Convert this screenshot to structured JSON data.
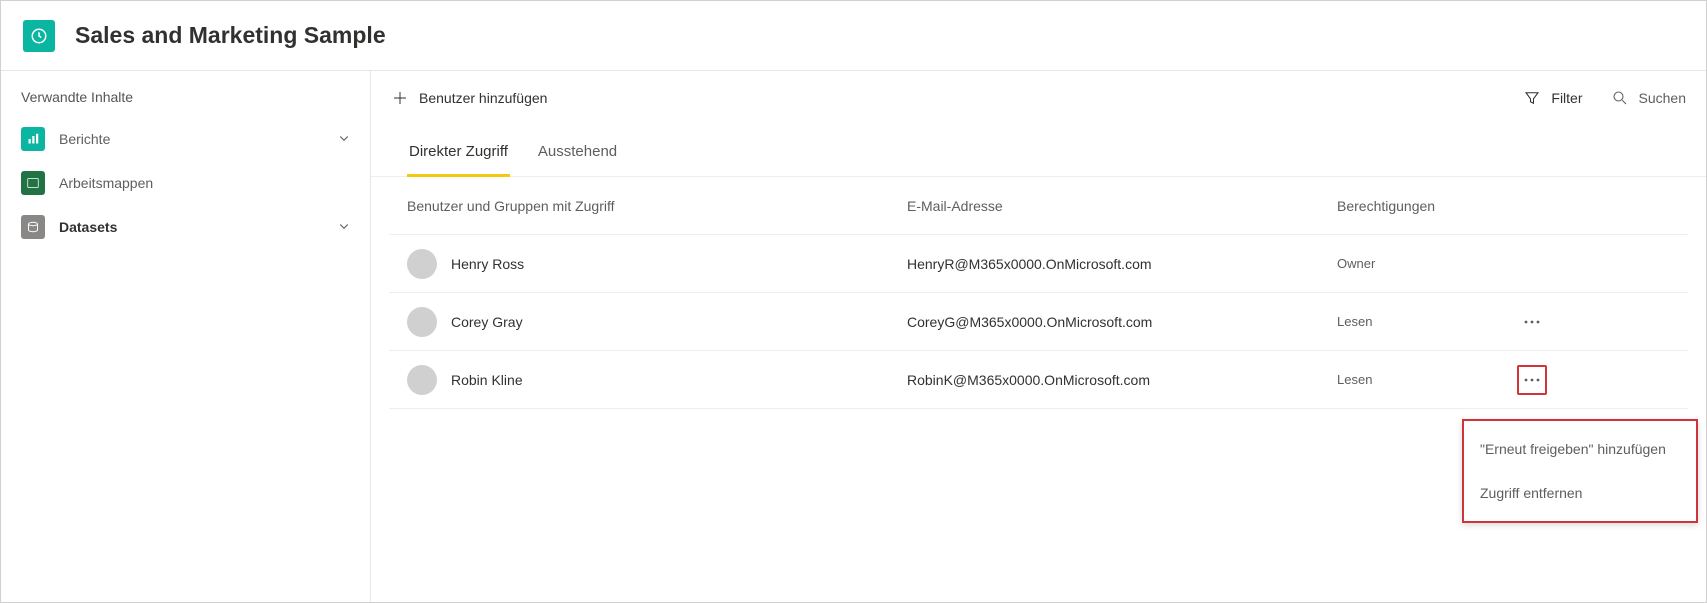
{
  "header": {
    "title": "Sales and Marketing Sample"
  },
  "sidebar": {
    "heading": "Verwandte Inhalte",
    "items": [
      {
        "label": "Berichte",
        "icon": "chart-bar-icon",
        "color_class": "sq-teal",
        "bold": false,
        "expandable": true
      },
      {
        "label": "Arbeitsmappen",
        "icon": "workbook-icon",
        "color_class": "sq-green",
        "bold": false,
        "expandable": false
      },
      {
        "label": "Datasets",
        "icon": "dataset-icon",
        "color_class": "sq-gray",
        "bold": true,
        "expandable": true
      }
    ]
  },
  "toolbar": {
    "add_user_label": "Benutzer hinzufügen",
    "filter_label": "Filter",
    "search_placeholder": "Suchen"
  },
  "tabs": [
    {
      "label": "Direkter Zugriff",
      "active": true
    },
    {
      "label": "Ausstehend",
      "active": false
    }
  ],
  "columns": {
    "users": "Benutzer und Gruppen mit Zugriff",
    "email": "E-Mail-Adresse",
    "perm": "Berechtigungen"
  },
  "rows": [
    {
      "name": "Henry Ross",
      "email": "HenryR@M365x0000.OnMicrosoft.com",
      "perm": "Owner",
      "has_menu": false,
      "menu_highlight": false
    },
    {
      "name": "Corey Gray",
      "email": "CoreyG@M365x0000.OnMicrosoft.com",
      "perm": "Lesen",
      "has_menu": true,
      "menu_highlight": false
    },
    {
      "name": "Robin Kline",
      "email": "RobinK@M365x0000.OnMicrosoft.com",
      "perm": "Lesen",
      "has_menu": true,
      "menu_highlight": true
    }
  ],
  "context_menu": {
    "items": [
      "\"Erneut freigeben\" hinzufügen",
      "Zugriff entfernen"
    ]
  },
  "colors": {
    "accent": "#f2c811",
    "brand": "#0ab5a2",
    "highlight_border": "#d13438"
  }
}
